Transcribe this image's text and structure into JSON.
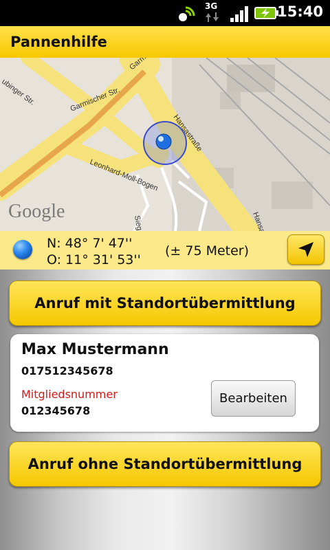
{
  "status_bar": {
    "network": "3G",
    "time": "15:40",
    "icons": [
      "sync-icon",
      "data-arrows-icon",
      "signal-icon",
      "battery-charging-icon"
    ]
  },
  "header": {
    "title": "Pannenhilfe"
  },
  "map": {
    "streets": [
      "ubinger Str.",
      "Garmischer Str.",
      "Garmi",
      "Hansastraße",
      "Leonhard-Moll-Bogen",
      "Sieg",
      "Hansa"
    ],
    "logo": "Google"
  },
  "location": {
    "lat": "N: 48° 7' 47''",
    "lon": "O: 11° 31' 53''",
    "accuracy": "(± 75 Meter)"
  },
  "actions": {
    "call_with_location": "Anruf mit Standortübermittlung",
    "call_without_location": "Anruf ohne Standortübermittlung"
  },
  "member": {
    "name": "Max Mustermann",
    "phone": "017512345678",
    "number_label": "Mitgliedsnummer",
    "number": "012345678",
    "edit_label": "Bearbeiten"
  },
  "colors": {
    "accent_yellow": "#f7c800",
    "label_red": "#d11a1a"
  }
}
